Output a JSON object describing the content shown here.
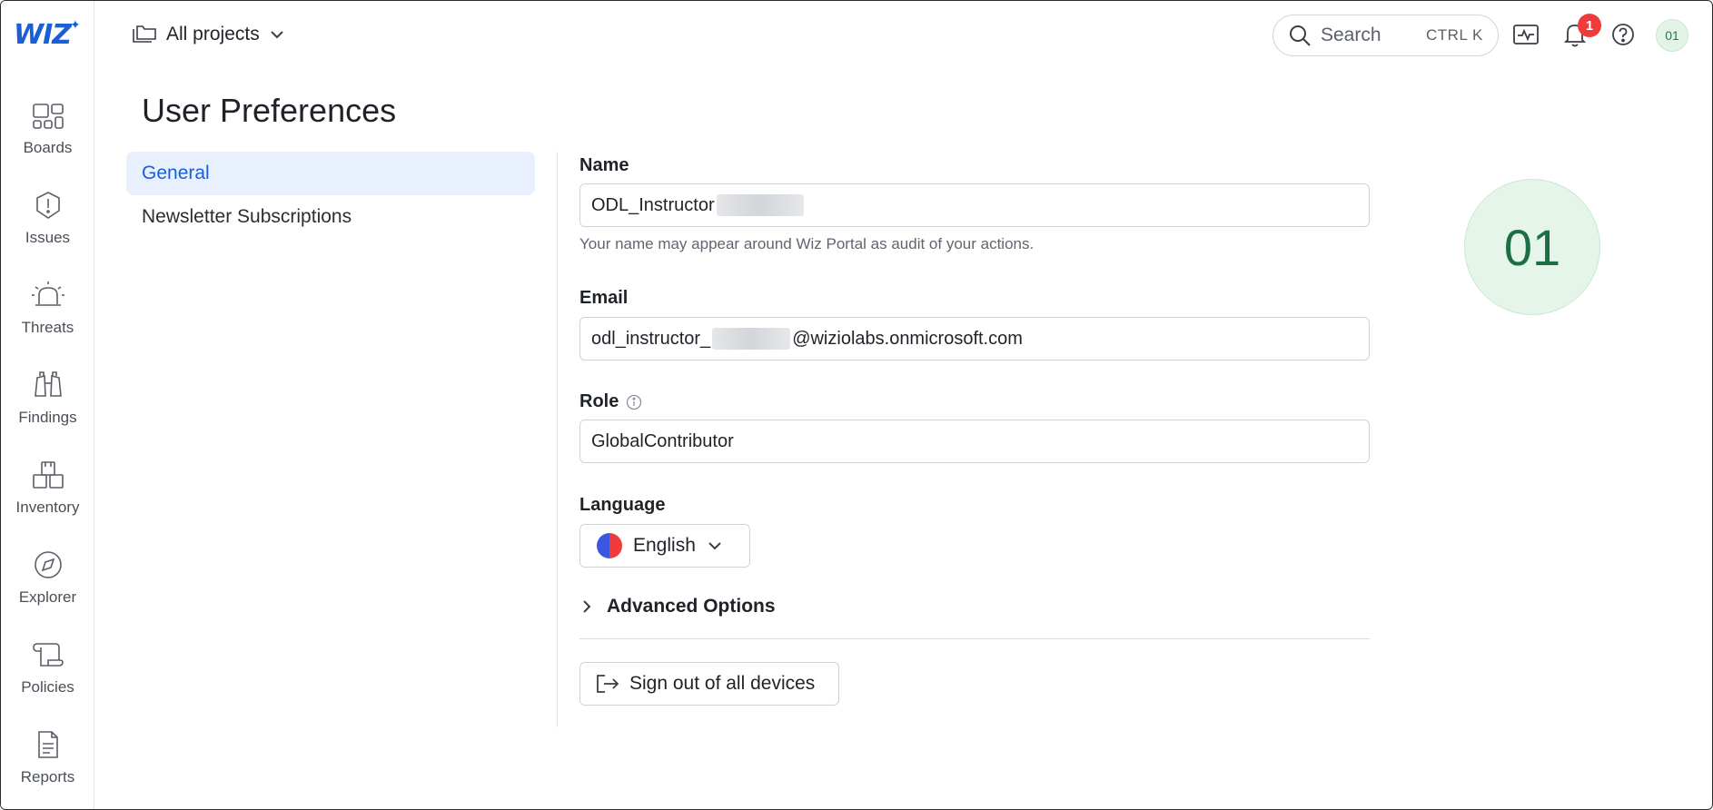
{
  "brand": {
    "logo_text": "WIZ",
    "accent": "#1a5ed8"
  },
  "leftnav": {
    "items": [
      {
        "label": "Boards",
        "icon": "boards-icon"
      },
      {
        "label": "Issues",
        "icon": "issues-icon"
      },
      {
        "label": "Threats",
        "icon": "threats-icon"
      },
      {
        "label": "Findings",
        "icon": "findings-icon"
      },
      {
        "label": "Inventory",
        "icon": "inventory-icon"
      },
      {
        "label": "Explorer",
        "icon": "explorer-icon"
      },
      {
        "label": "Policies",
        "icon": "policies-icon"
      },
      {
        "label": "Reports",
        "icon": "reports-icon"
      }
    ]
  },
  "topbar": {
    "projects_label": "All projects",
    "search_label": "Search",
    "search_shortcut": "CTRL  K",
    "notifications_count": "1",
    "avatar_initials": "01"
  },
  "page": {
    "title": "User Preferences",
    "subnav": [
      {
        "label": "General",
        "active": true
      },
      {
        "label": "Newsletter Subscriptions",
        "active": false
      }
    ]
  },
  "form": {
    "name": {
      "label": "Name",
      "value": "ODL_Instructor",
      "help": "Your name may appear around Wiz Portal as audit of your actions."
    },
    "email": {
      "label": "Email",
      "value_prefix": "odl_instructor_",
      "value_suffix": "@wiziolabs.onmicrosoft.com"
    },
    "role": {
      "label": "Role",
      "value": "GlobalContributor"
    },
    "language": {
      "label": "Language",
      "value": "English"
    },
    "advanced_label": "Advanced Options",
    "signout_label": "Sign out of all devices"
  },
  "profile": {
    "avatar_initials": "01"
  }
}
